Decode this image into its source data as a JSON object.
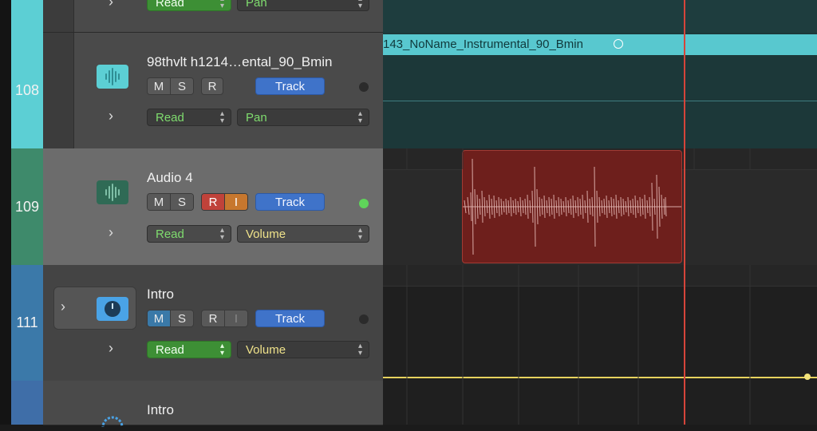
{
  "tracks": [
    {
      "number": "",
      "name": "",
      "automation_mode": "Read",
      "parameter": "Pan",
      "header_color": "#5ccfd4"
    },
    {
      "number": "108",
      "name": "98thvlt  h1214…ental_90_Bmin",
      "mute": "M",
      "solo": "S",
      "record": "R",
      "track_button": "Track",
      "automation_mode": "Read",
      "parameter": "Pan",
      "icon": "waveform-icon",
      "header_color": "#5ccfd4",
      "region_name": "143_NoName_Instrumental_90_Bmin"
    },
    {
      "number": "109",
      "name": "Audio 4",
      "mute": "M",
      "solo": "S",
      "record": "R",
      "input": "I",
      "track_button": "Track",
      "automation_mode": "Read",
      "parameter": "Volume",
      "icon": "waveform-icon",
      "header_color": "#3e8a6b"
    },
    {
      "number": "111",
      "name": "Intro",
      "mute": "M",
      "solo": "S",
      "record": "R",
      "input": "I",
      "track_button": "Track",
      "automation_mode": "Read",
      "parameter": "Volume",
      "icon": "gauge-icon",
      "header_color": "#3b79a9"
    },
    {
      "number": "",
      "name": "Intro",
      "icon": "flower-icon",
      "header_color": "#3f6ea8"
    }
  ],
  "colors": {
    "cyan_region": "#58c8cf",
    "audio_region": "#6e1f1c",
    "playhead": "#d6443a",
    "track_button": "#3f73c9",
    "automation_line": "#e7d25e"
  }
}
